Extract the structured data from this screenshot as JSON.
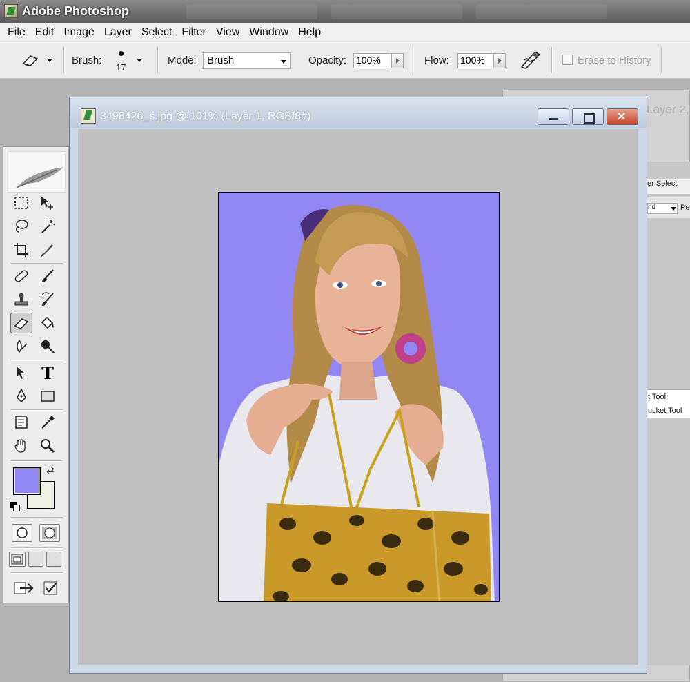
{
  "app": {
    "title": "Adobe Photoshop"
  },
  "menu": [
    "File",
    "Edit",
    "Image",
    "Layer",
    "Select",
    "Filter",
    "View",
    "Window",
    "Help"
  ],
  "options": {
    "brush_label": "Brush:",
    "brush_size": "17",
    "mode_label": "Mode:",
    "mode_value": "Brush",
    "opacity_label": "Opacity:",
    "opacity_value": "100%",
    "flow_label": "Flow:",
    "flow_value": "100%",
    "erase_history_label": "Erase to History"
  },
  "document": {
    "title": "3498426_s.jpg @ 101% (Layer 1, RGB/8#)"
  },
  "background_window": {
    "title_fragment": "Layer 2,",
    "menu_fragment": "er  Select",
    "mode_fragment": "nd",
    "opt_fragment": "Pe",
    "tool_list": [
      "t Tool",
      "ucket Tool"
    ]
  },
  "colors": {
    "foreground": "#9287f2",
    "background": "#eef0e4",
    "canvas_bg": "#9287f2"
  },
  "toolbox": {
    "tools": [
      "marquee-tool-icon",
      "move-tool-icon",
      "lasso-tool-icon",
      "magic-wand-icon",
      "crop-tool-icon",
      "slice-tool-icon",
      "healing-brush-icon",
      "brush-tool-icon",
      "clone-stamp-icon",
      "history-brush-icon",
      "eraser-tool-icon",
      "paint-bucket-icon",
      "blur-tool-icon",
      "dodge-tool-icon",
      "path-selection-icon",
      "type-tool-icon",
      "pen-tool-icon",
      "rectangle-tool-icon",
      "notes-tool-icon",
      "eyedropper-icon",
      "hand-tool-icon",
      "zoom-tool-icon"
    ],
    "active_tool": "eraser-tool-icon",
    "type_glyph": "T"
  }
}
